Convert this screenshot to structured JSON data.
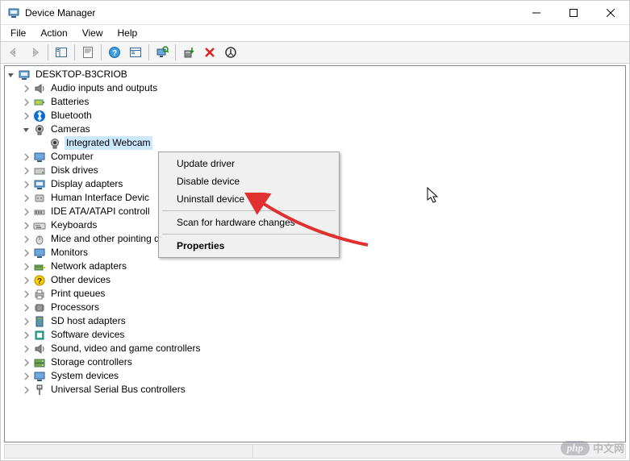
{
  "window": {
    "title": "Device Manager",
    "controls": {
      "min": "—",
      "max": "▢",
      "close": "✕"
    }
  },
  "menubar": [
    "File",
    "Action",
    "View",
    "Help"
  ],
  "tree": {
    "root": "DESKTOP-B3CRIOB",
    "categories": [
      {
        "label": "Audio inputs and outputs",
        "expanded": false
      },
      {
        "label": "Batteries",
        "expanded": false
      },
      {
        "label": "Bluetooth",
        "expanded": false
      },
      {
        "label": "Cameras",
        "expanded": true,
        "children": [
          {
            "label": "Integrated Webcam",
            "selected": true
          }
        ]
      },
      {
        "label": "Computer",
        "expanded": false
      },
      {
        "label": "Disk drives",
        "expanded": false
      },
      {
        "label": "Display adapters",
        "expanded": false
      },
      {
        "label": "Human Interface Devices",
        "expanded": false,
        "truncated": "Human Interface Devic"
      },
      {
        "label": "IDE ATA/ATAPI controllers",
        "expanded": false,
        "truncated": "IDE ATA/ATAPI controll"
      },
      {
        "label": "Keyboards",
        "expanded": false
      },
      {
        "label": "Mice and other pointing devices",
        "expanded": false
      },
      {
        "label": "Monitors",
        "expanded": false
      },
      {
        "label": "Network adapters",
        "expanded": false
      },
      {
        "label": "Other devices",
        "expanded": false
      },
      {
        "label": "Print queues",
        "expanded": false
      },
      {
        "label": "Processors",
        "expanded": false
      },
      {
        "label": "SD host adapters",
        "expanded": false
      },
      {
        "label": "Software devices",
        "expanded": false
      },
      {
        "label": "Sound, video and game controllers",
        "expanded": false
      },
      {
        "label": "Storage controllers",
        "expanded": false
      },
      {
        "label": "System devices",
        "expanded": false
      },
      {
        "label": "Universal Serial Bus controllers",
        "expanded": false
      }
    ]
  },
  "context_menu": {
    "items": [
      "Update driver",
      "Disable device",
      "Uninstall device",
      "-",
      "Scan for hardware changes",
      "-",
      "Properties"
    ],
    "default": "Properties"
  },
  "watermark": {
    "logo": "php",
    "text": "中文网"
  }
}
